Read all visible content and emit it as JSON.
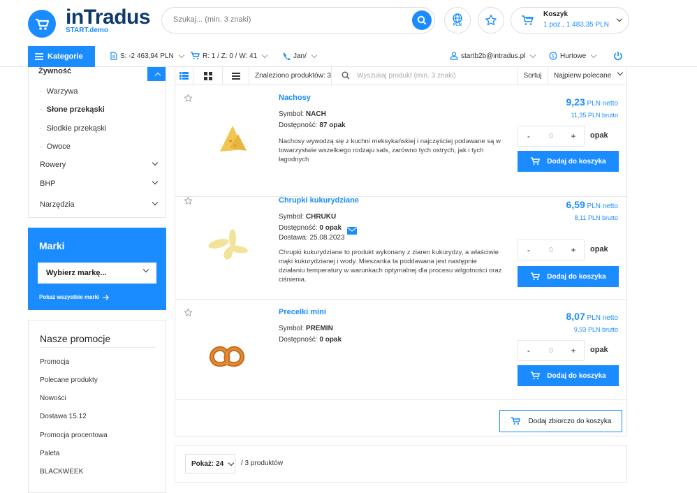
{
  "header": {
    "logo_title": "inTradus",
    "logo_sub": "START.demo",
    "search_placeholder": "Szukaj... (min. 3 znaki)",
    "currency_label": "PLN",
    "cart_title": "Koszyk",
    "cart_summary": "1 poz., 1 483,35 PLN"
  },
  "toolbar": {
    "categories_label": "Kategorie",
    "balance": "S: -2 463,94 PLN",
    "orders_r": "R: 1 / Z: 0 / W: 41",
    "user_short": "Jan/",
    "email": "startb2b@intradus.pl",
    "price_mode": "Hurtowe"
  },
  "sidebar": {
    "active_category": "Żywność",
    "subcategories": [
      "Warzywa",
      "Słone przekąski",
      "Słodkie przekąski",
      "Owoce"
    ],
    "categories": [
      "Rowery",
      "BHP",
      "Narzędzia"
    ]
  },
  "brands": {
    "title": "Marki",
    "select_label": "Wybierz markę...",
    "show_all": "Pokaż wszystkie marki"
  },
  "promotions": {
    "title": "Nasze promocje",
    "items": [
      "Promocja",
      "Polecane produkty",
      "Nowości",
      "Dostawa 15.12",
      "Promocja procentowa",
      "Paleta",
      "BLACKWEEK"
    ]
  },
  "list": {
    "found": "Znaleziono produktów: 3",
    "search_placeholder": "Wyszukaj produkt (min. 3 znaki)",
    "sort_label": "Sortuj",
    "sort_value": "Najpierw polecane"
  },
  "products": [
    {
      "name": "Nachosy",
      "symbol_label": "Symbol:",
      "symbol": "NACH",
      "availability_label": "Dostępność:",
      "availability": "87 opak",
      "delivery": "",
      "description": "Nachosy wywodzą się z kuchni meksykańskiej i najczęściej podawane są w towarzystwie wszelkiego rodzaju sals, zarówno tych ostrych, jak i tych łagodnych",
      "price_net": "9,23",
      "net_label": "PLN netto",
      "price_gross": "11,35",
      "gross_label": "PLN brutto",
      "qty": "0",
      "unit": "opak",
      "add_label": "Dodaj do koszyka"
    },
    {
      "name": "Chrupki kukurydziane",
      "symbol_label": "Symbol:",
      "symbol": "CHRUKU",
      "availability_label": "Dostępność:",
      "availability": "0 opak",
      "delivery": "Dostawa: 25.08.2023",
      "description": "Chrupki kukurydziane to produkt wykonany z ziaren kukurydzy, a właściwie mąki kukurydzianej i wody. Mieszanka ta poddawana jest następnie działaniu temperatury w warunkach optymalnej dla procesu wilgotności oraz ciśnienia.",
      "price_net": "6,59",
      "net_label": "PLN netto",
      "price_gross": "8,11",
      "gross_label": "PLN brutto",
      "qty": "0",
      "unit": "opak",
      "add_label": "Dodaj do koszyka"
    },
    {
      "name": "Precelki mini",
      "symbol_label": "Symbol:",
      "symbol": "PREMIN",
      "availability_label": "Dostępność:",
      "availability": "0 opak",
      "delivery": "",
      "description": "",
      "price_net": "8,07",
      "net_label": "PLN netto",
      "price_gross": "9,93",
      "gross_label": "PLN brutto",
      "qty": "0",
      "unit": "opak",
      "add_label": "Dodaj do koszyka"
    }
  ],
  "bulk_add_label": "Dodaj zbiorczo do koszyka",
  "pager": {
    "per_page": "Pokaż: 24",
    "count": "/  3  produktów"
  },
  "colors": {
    "accent": "#1a8cff",
    "logo_dark": "#0d3a6b"
  }
}
